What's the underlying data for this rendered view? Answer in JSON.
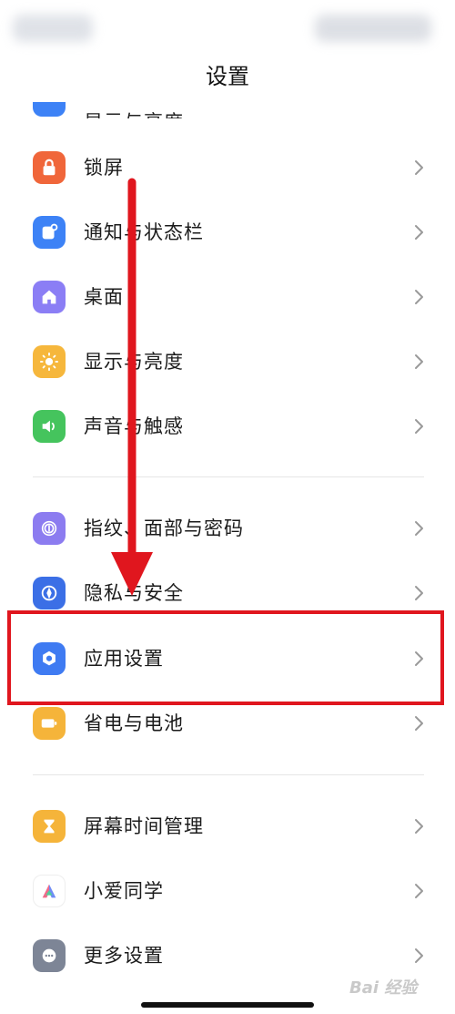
{
  "header": {
    "title": "设置"
  },
  "partial_item": {
    "label": "显示与亮度"
  },
  "items": [
    {
      "label": "锁屏",
      "icon": "lock-icon",
      "color": "#f0663a"
    },
    {
      "label": "通知与状态栏",
      "icon": "notification-icon",
      "color": "#3d82f6"
    },
    {
      "label": "桌面",
      "icon": "home-icon",
      "color": "#8b7ef5"
    },
    {
      "label": "显示与亮度",
      "icon": "sun-icon",
      "color": "#f6b73c"
    },
    {
      "label": "声音与触感",
      "icon": "speaker-icon",
      "color": "#45c45d"
    },
    {
      "label": "指纹、面部与密码",
      "icon": "fingerprint-icon",
      "color": "#8c7cf0"
    },
    {
      "label": "隐私与安全",
      "icon": "privacy-icon",
      "color": "#3b6fe6"
    },
    {
      "label": "应用设置",
      "icon": "app-settings-icon",
      "color": "#3f7bf2"
    },
    {
      "label": "省电与电池",
      "icon": "battery-icon",
      "color": "#f5b43a"
    },
    {
      "label": "屏幕时间管理",
      "icon": "hourglass-icon",
      "color": "#f5b43a"
    },
    {
      "label": "小爱同学",
      "icon": "xiaoai-icon",
      "color": "#ffffff"
    },
    {
      "label": "更多设置",
      "icon": "more-icon",
      "color": "#7d8596"
    }
  ],
  "annotation": {
    "arrow_color": "#e0161e",
    "highlight_color": "#e0161e"
  },
  "watermark": {
    "text": "Bai 经验"
  }
}
